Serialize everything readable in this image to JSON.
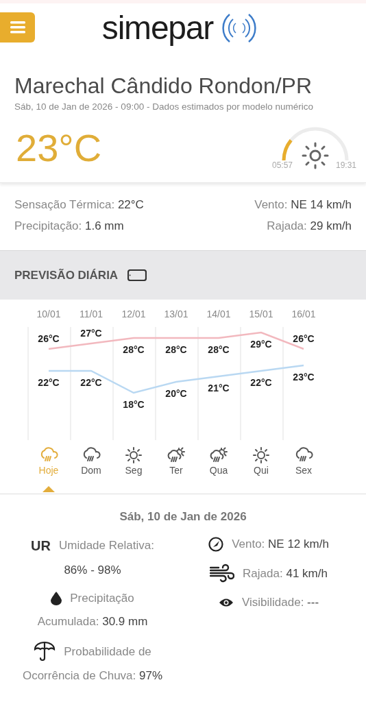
{
  "header": {
    "logo": "simepar"
  },
  "location": {
    "title": "Marechal Cândido Rondon/PR",
    "subtitle": "Sáb, 10 de Jan de 2026 - 09:00 - Dados estimados por modelo numérico",
    "temperature": "23°C",
    "sun": {
      "sunrise": "05:57",
      "sunset": "19:31"
    }
  },
  "current": {
    "left": [
      {
        "label": "Sensação Térmica:",
        "value": "22°C"
      },
      {
        "label": "Precipitação:",
        "value": "1.6 mm"
      }
    ],
    "right": [
      {
        "label": "Vento:",
        "value": "NE 14 km/h"
      },
      {
        "label": "Rajada:",
        "value": "29 km/h"
      }
    ]
  },
  "section_title": "PREVISÃO DIÁRIA",
  "forecast": {
    "chart_data": {
      "type": "line",
      "categories": [
        "10/01",
        "11/01",
        "12/01",
        "13/01",
        "14/01",
        "15/01",
        "16/01"
      ],
      "series": [
        {
          "color": "#f2b8be",
          "values": [
            26,
            27,
            28,
            28,
            28,
            29,
            26
          ],
          "value_labels": [
            "26°C",
            "27°C",
            "28°C",
            "28°C",
            "28°C",
            "29°C",
            "26°C"
          ]
        },
        {
          "color": "#b9d8f2",
          "values": [
            22,
            22,
            18,
            20,
            21,
            22,
            23
          ],
          "value_labels": [
            "22°C",
            "22°C",
            "18°C",
            "20°C",
            "21°C",
            "22°C",
            "23°C"
          ]
        }
      ]
    },
    "days": [
      {
        "label": "Hoje",
        "kind": "rain",
        "selected": true
      },
      {
        "label": "Dom",
        "kind": "rain",
        "selected": false
      },
      {
        "label": "Seg",
        "kind": "sun",
        "selected": false
      },
      {
        "label": "Ter",
        "kind": "sun-rain",
        "selected": false
      },
      {
        "label": "Qua",
        "kind": "sun-rain",
        "selected": false
      },
      {
        "label": "Qui",
        "kind": "sun",
        "selected": false
      },
      {
        "label": "Sex",
        "kind": "rain",
        "selected": false
      }
    ]
  },
  "detail": {
    "date": "Sáb, 10 de Jan de 2026",
    "left": [
      {
        "kind": "ur",
        "badge": "UR",
        "line1": "Umidade Relativa:",
        "value": "86% - 98%"
      },
      {
        "kind": "drop",
        "line1": "Precipitação",
        "label": "Acumulada:",
        "value": "30.9 mm"
      },
      {
        "kind": "umbrella",
        "line1": "Probabilidade de",
        "label": "Ocorrência de Chuva:",
        "value": "97%"
      }
    ],
    "right": [
      {
        "kind": "compass",
        "label": "Vento:",
        "value": "NE 12 km/h"
      },
      {
        "kind": "wind",
        "label": "Rajada:",
        "value": "41 km/h"
      },
      {
        "kind": "eye",
        "label": "Visibilidade:",
        "value": "---"
      }
    ]
  }
}
